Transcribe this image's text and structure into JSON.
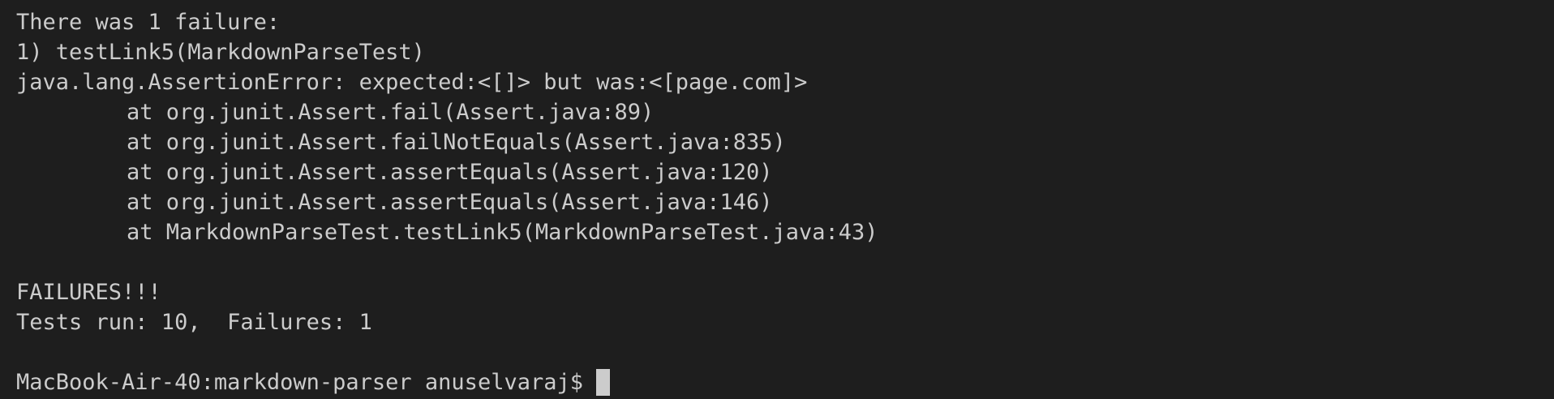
{
  "terminal": {
    "output": {
      "failure_header": "There was 1 failure:",
      "failure_name": "1) testLink5(MarkdownParseTest)",
      "error_message": "java.lang.AssertionError: expected:<[]> but was:<[page.com]>",
      "stack_trace": [
        "at org.junit.Assert.fail(Assert.java:89)",
        "at org.junit.Assert.failNotEquals(Assert.java:835)",
        "at org.junit.Assert.assertEquals(Assert.java:120)",
        "at org.junit.Assert.assertEquals(Assert.java:146)",
        "at MarkdownParseTest.testLink5(MarkdownParseTest.java:43)"
      ],
      "summary_label": "FAILURES!!!",
      "summary_counts": "Tests run: 10,  Failures: 1"
    },
    "prompt": {
      "text": "MacBook-Air-40:markdown-parser anuselvaraj$"
    },
    "colors": {
      "background": "#1e1e1e",
      "foreground": "#cccccc"
    }
  }
}
